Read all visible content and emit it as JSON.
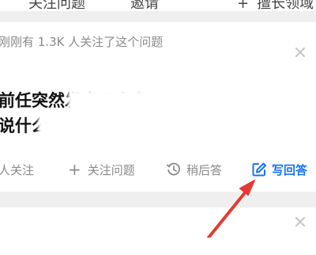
{
  "topbar": {
    "tab_a": "关注问题",
    "tab_b": "邀请",
    "tab_c_plus": "+",
    "tab_c": "擅长领域"
  },
  "card": {
    "notice": "刚刚有 1.3K 人关注了这个问题",
    "title_line1": "前任突然发来三个字，",
    "title_line2": "说什么",
    "actions": {
      "followers": "人关注",
      "follow_plus": "+",
      "follow": "关注问题",
      "later": "稍后答",
      "answer": "写回答"
    }
  },
  "colors": {
    "accent": "#1772f6",
    "arrow": "#e53935",
    "muted_text": "#8a8a8a",
    "title_text": "#121212"
  },
  "icons": [
    "close-icon",
    "clock-icon",
    "edit-icon",
    "plus-icon"
  ]
}
